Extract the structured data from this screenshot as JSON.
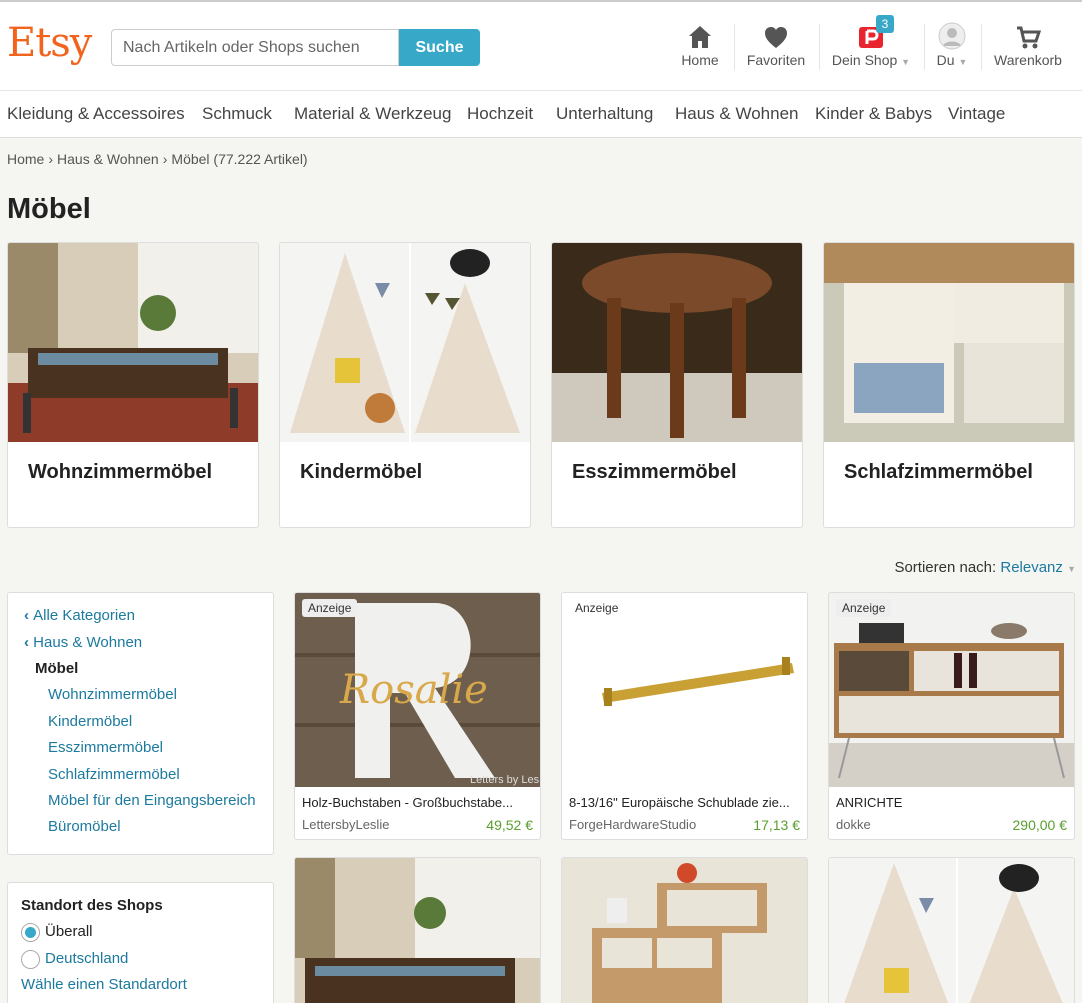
{
  "header": {
    "logo": "Etsy",
    "search_placeholder": "Nach Artikeln oder Shops suchen",
    "search_button": "Suche",
    "nav": {
      "home": "Home",
      "favorites": "Favoriten",
      "shop": "Dein Shop",
      "shop_badge": "3",
      "you": "Du",
      "cart": "Warenkorb"
    }
  },
  "categories": [
    "Kleidung & Accessoires",
    "Schmuck",
    "Material & Werkzeug",
    "Hochzeit",
    "Unterhaltung",
    "Haus & Wohnen",
    "Kinder & Babys",
    "Vintage"
  ],
  "breadcrumb": {
    "home": "Home",
    "parent": "Haus & Wohnen",
    "current": "Möbel (77.222 Artikel)"
  },
  "page_title": "Möbel",
  "category_cards": [
    "Wohnzimmermöbel",
    "Kindermöbel",
    "Esszimmermöbel",
    "Schlafzimmermöbel"
  ],
  "sort": {
    "label": "Sortieren nach:",
    "value": "Relevanz"
  },
  "sidebar": {
    "all": "Alle Kategorien",
    "parent": "Haus & Wohnen",
    "current": "Möbel",
    "subs": [
      "Wohnzimmermöbel",
      "Kindermöbel",
      "Esszimmermöbel",
      "Schlafzimmermöbel",
      "Möbel für den Eingangsbereich",
      "Büromöbel"
    ]
  },
  "location": {
    "title": "Standort des Shops",
    "opt_all": "Überall",
    "opt_de": "Deutschland",
    "link": "Wähle einen Standardort"
  },
  "listings": [
    {
      "ad": "Anzeige",
      "title": "Holz-Buchstaben - Großbuchstabe...",
      "shop": "LettersbyLeslie",
      "price": "49,52 €",
      "img_text": "Rosalie",
      "watermark": "Letters by Les"
    },
    {
      "ad": "Anzeige",
      "title": "8-13/16\" Europäische Schublade zie...",
      "shop": "ForgeHardwareStudio",
      "price": "17,13 €"
    },
    {
      "ad": "Anzeige",
      "title": "ANRICHTE",
      "shop": "dokke",
      "price": "290,00 €"
    }
  ],
  "colors": {
    "brand": "#f1641e",
    "accent": "#38a8c9",
    "link": "#1c7a9e",
    "price": "#5a9e2f"
  }
}
